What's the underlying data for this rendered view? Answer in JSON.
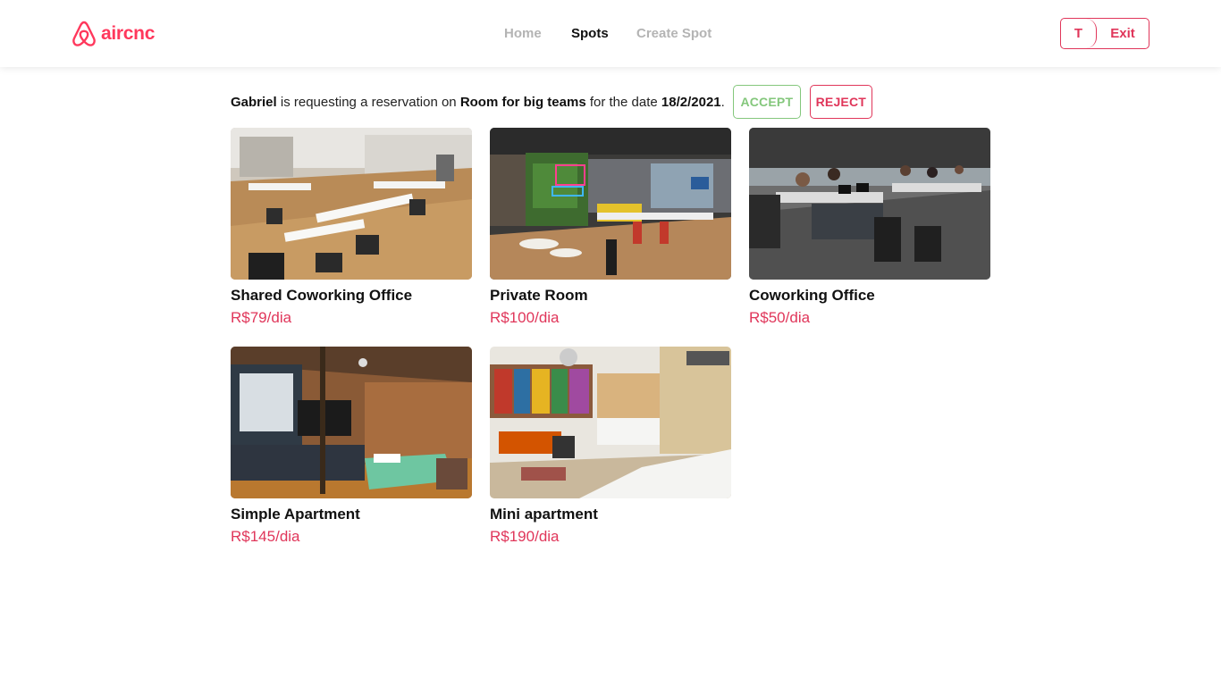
{
  "brand": {
    "name": "aircnc",
    "accent": "#ff385c"
  },
  "nav": [
    {
      "label": "Home",
      "active": false
    },
    {
      "label": "Spots",
      "active": true
    },
    {
      "label": "Create Spot",
      "active": false
    }
  ],
  "user": {
    "initial": "T",
    "exit_label": "Exit"
  },
  "request": {
    "user": "Gabriel",
    "text1": " is requesting a reservation on ",
    "spot": "Room for big teams",
    "text2": " for the date ",
    "date": "18/2/2021",
    "text3": ".",
    "accept_label": "ACCEPT",
    "reject_label": "REJECT",
    "accept_color": "#84c77c",
    "reject_color": "#e0365a"
  },
  "spots": [
    {
      "title": "Shared Coworking Office",
      "price": "R$79/dia",
      "image": "open office with white desks and wooden floor"
    },
    {
      "title": "Private Room",
      "price": "R$100/dia",
      "image": "lounge with green wall and neon sign"
    },
    {
      "title": "Coworking Office",
      "price": "R$50/dia",
      "image": "crowded coworking hall"
    },
    {
      "title": "Simple Apartment",
      "price": "R$145/dia",
      "image": "wooden bedroom with tv"
    },
    {
      "title": "Mini apartment",
      "price": "R$190/dia",
      "image": "studio with bookshelf and bed"
    }
  ]
}
